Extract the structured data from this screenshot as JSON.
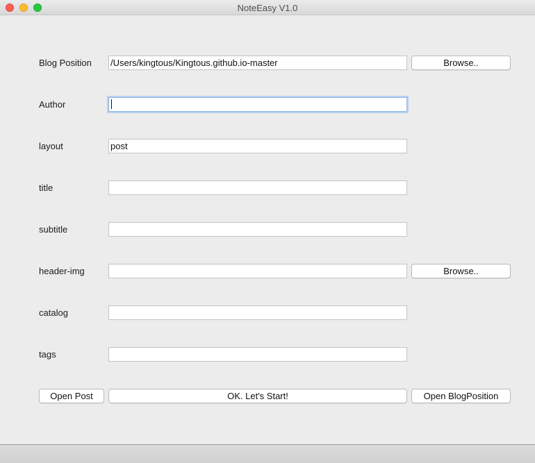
{
  "window": {
    "title": "NoteEasy V1.0"
  },
  "form": {
    "blog_position": {
      "label": "Blog Position",
      "value": "/Users/kingtous/Kingtous.github.io-master",
      "browse_label": "Browse.."
    },
    "author": {
      "label": "Author",
      "value": ""
    },
    "layout": {
      "label": "layout",
      "value": "post"
    },
    "title": {
      "label": "title",
      "value": ""
    },
    "subtitle": {
      "label": "subtitle",
      "value": ""
    },
    "header_img": {
      "label": "header-img",
      "value": "",
      "browse_label": "Browse.."
    },
    "catalog": {
      "label": "catalog",
      "value": ""
    },
    "tags": {
      "label": "tags",
      "value": ""
    }
  },
  "actions": {
    "open_post": "Open Post",
    "start": "OK. Let's Start!",
    "open_blog_position": "Open BlogPosition"
  }
}
